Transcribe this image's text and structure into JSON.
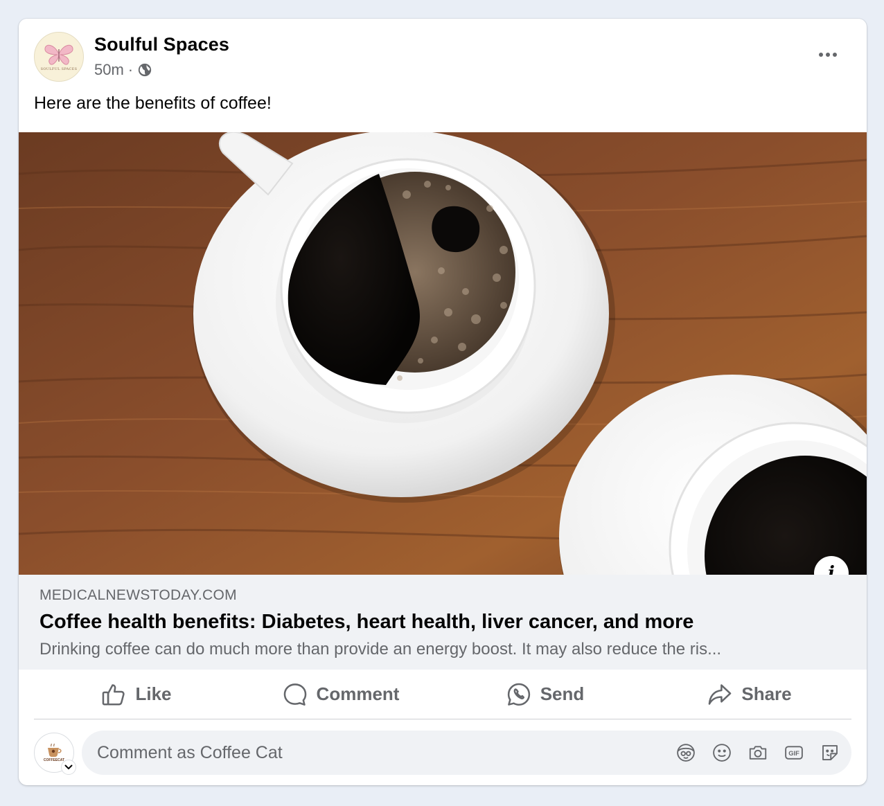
{
  "post": {
    "author": "Soulful Spaces",
    "avatar_text": "SOULFUL SPACES",
    "time": "50m",
    "separator": "·",
    "privacy_icon": "globe-icon",
    "text": "Here are the benefits of coffee!"
  },
  "link": {
    "domain": "MEDICALNEWSTODAY.COM",
    "title": "Coffee health benefits: Diabetes, heart health, liver cancer, and more",
    "description": "Drinking coffee can do much more than provide an energy boost. It may also reduce the ris...",
    "info_label": "i"
  },
  "actions": [
    {
      "label": "Like",
      "icon": "thumbs-up-icon"
    },
    {
      "label": "Comment",
      "icon": "comment-bubble-icon"
    },
    {
      "label": "Send",
      "icon": "whatsapp-icon"
    },
    {
      "label": "Share",
      "icon": "share-arrow-icon"
    }
  ],
  "comment": {
    "avatar_text": "COFFEECAT",
    "placeholder": "Comment as Coffee Cat",
    "tools": [
      "avatar-sticker-icon",
      "emoji-icon",
      "camera-icon",
      "gif-icon",
      "sticker-icon"
    ]
  },
  "colors": {
    "background": "#e9eef6",
    "card": "#ffffff",
    "secondary_text": "#65676b",
    "link_preview_bg": "#f0f2f5"
  }
}
